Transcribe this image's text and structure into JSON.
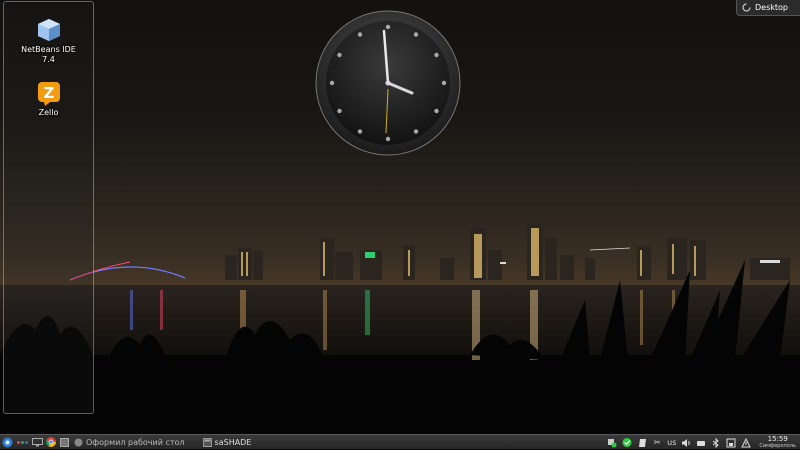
{
  "desktop": {
    "icons": [
      {
        "label": "NetBeans IDE\n7.4",
        "icon": "netbeans-cube-icon"
      },
      {
        "label": "Zello",
        "icon": "zello-icon"
      }
    ],
    "toolbox_label": "Desktop"
  },
  "clock": {
    "time": "15:59"
  },
  "taskbar": {
    "tasks": [
      {
        "label": "Оформил рабочий стол",
        "icon": "browser-tab-icon"
      },
      {
        "label": "saSHADE",
        "icon": "app-window-icon"
      }
    ],
    "tray": {
      "keyboard_layout": "us",
      "time": "15:59",
      "city": "Симферополь"
    }
  },
  "colors": {
    "taskbar_bg": "#2b2b2b",
    "zello_orange": "#f39c12",
    "tray_green": "#2ecc40"
  }
}
